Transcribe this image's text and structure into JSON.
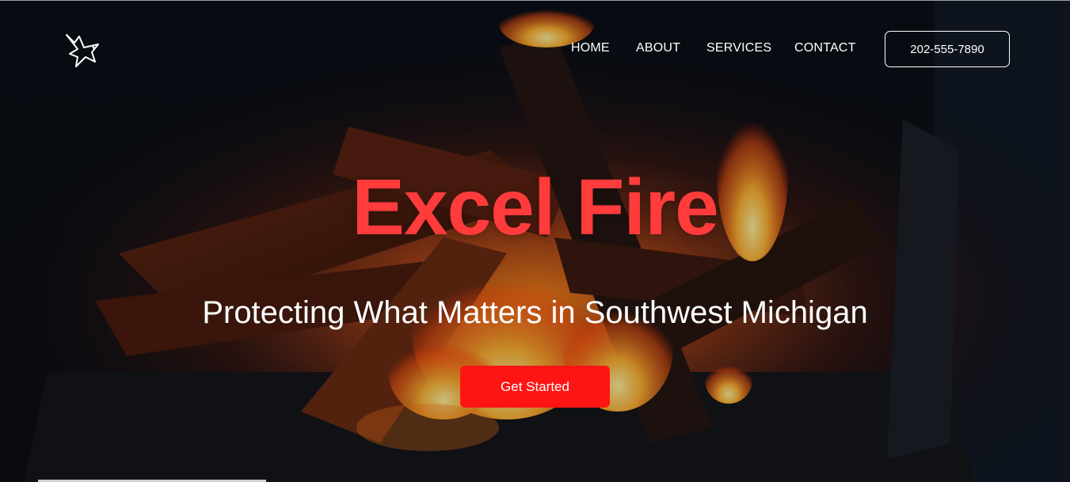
{
  "brand": {
    "logo_icon": "dove-icon"
  },
  "nav": {
    "items": [
      {
        "label": "HOME"
      },
      {
        "label": "ABOUT"
      },
      {
        "label": "SERVICES"
      },
      {
        "label": "CONTACT"
      }
    ],
    "phone": "202-555-7890"
  },
  "hero": {
    "title": "Excel Fire",
    "subtitle": "Protecting What Matters in Southwest Michigan",
    "cta_label": "Get Started",
    "title_color": "#ff3b3b",
    "cta_color": "#ff1414"
  }
}
